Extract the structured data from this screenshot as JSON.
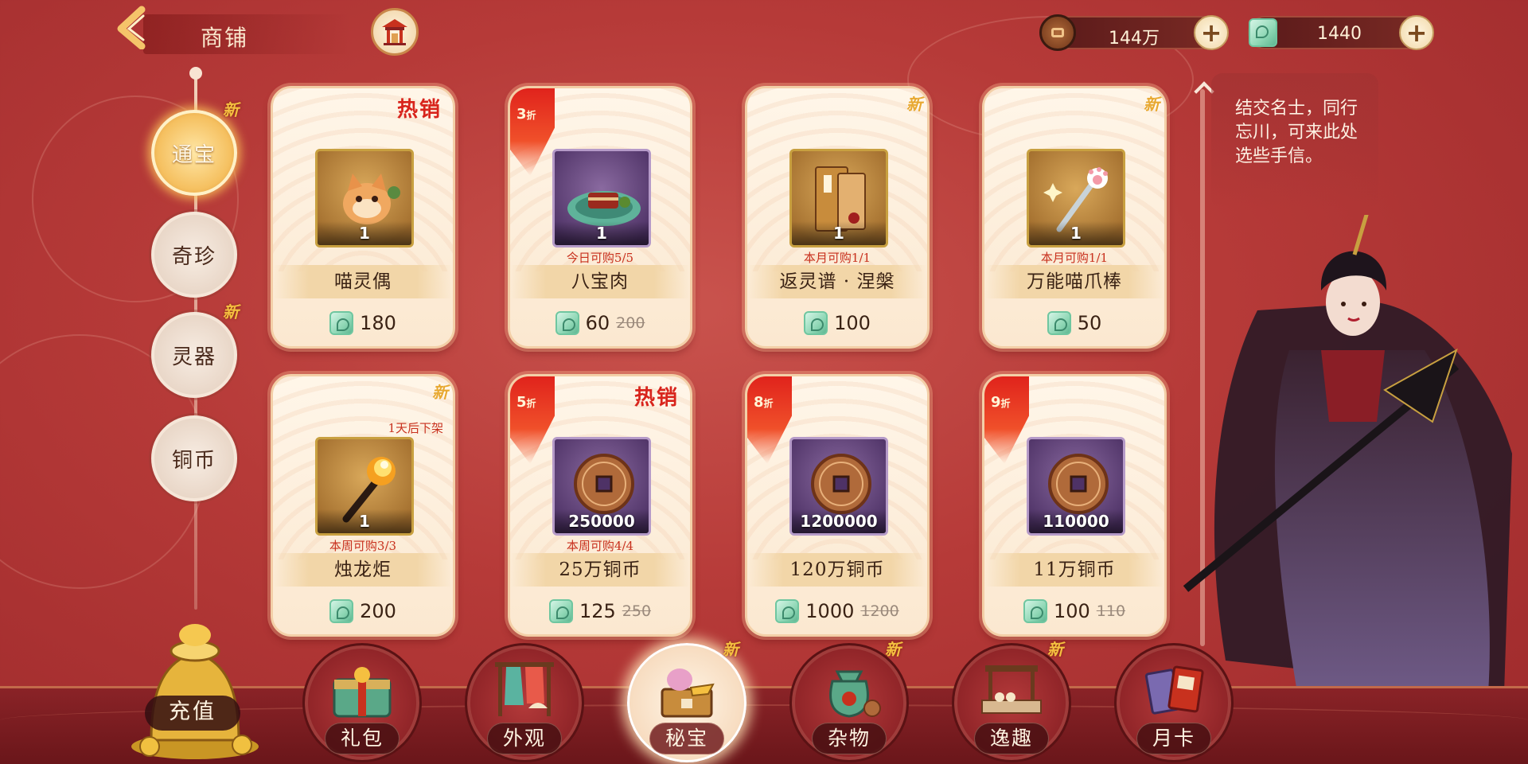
{
  "header": {
    "title": "商铺"
  },
  "currencies": [
    {
      "icon": "copper-coin-icon",
      "value": "144万"
    },
    {
      "icon": "jade-icon",
      "value": "1440"
    }
  ],
  "categories": [
    {
      "label": "通宝",
      "active": true,
      "new": "新"
    },
    {
      "label": "奇珍",
      "active": false,
      "new": ""
    },
    {
      "label": "灵器",
      "active": false,
      "new": "新"
    },
    {
      "label": "铜币",
      "active": false,
      "new": ""
    }
  ],
  "products": [
    {
      "name": "喵灵偶",
      "qty": "1",
      "price": "180",
      "original": "",
      "badge": "热销",
      "discount": "",
      "discount_unit": "",
      "new": "",
      "limit": "",
      "expire": "",
      "icon": "cat-doll-icon"
    },
    {
      "name": "八宝肉",
      "qty": "1",
      "price": "60",
      "original": "200",
      "badge": "",
      "discount": "3",
      "discount_unit": "折",
      "new": "",
      "limit": "今日可购5/5",
      "expire": "",
      "icon": "braised-pork-icon"
    },
    {
      "name": "返灵谱 · 涅槃",
      "qty": "1",
      "price": "100",
      "original": "",
      "badge": "",
      "discount": "",
      "discount_unit": "",
      "new": "新",
      "limit": "本月可购1/1",
      "expire": "",
      "icon": "scroll-book-icon"
    },
    {
      "name": "万能喵爪棒",
      "qty": "1",
      "price": "50",
      "original": "",
      "badge": "",
      "discount": "",
      "discount_unit": "",
      "new": "新",
      "limit": "本月可购1/1",
      "expire": "",
      "icon": "paw-wand-icon"
    },
    {
      "name": "烛龙炬",
      "qty": "1",
      "price": "200",
      "original": "",
      "badge": "",
      "discount": "",
      "discount_unit": "",
      "new": "新",
      "limit": "本周可购3/3",
      "expire": "1天后下架",
      "icon": "torch-icon"
    },
    {
      "name": "25万铜币",
      "qty": "250000",
      "price": "125",
      "original": "250",
      "badge": "热销",
      "discount": "5",
      "discount_unit": "折",
      "new": "",
      "limit": "本周可购4/4",
      "expire": "",
      "icon": "copper-coin-icon"
    },
    {
      "name": "120万铜币",
      "qty": "1200000",
      "price": "1000",
      "original": "1200",
      "badge": "",
      "discount": "8",
      "discount_unit": "折",
      "new": "",
      "limit": "",
      "expire": "",
      "icon": "copper-coin-icon"
    },
    {
      "name": "11万铜币",
      "qty": "110000",
      "price": "100",
      "original": "110",
      "badge": "",
      "discount": "9",
      "discount_unit": "折",
      "new": "",
      "limit": "",
      "expire": "",
      "icon": "copper-coin-icon"
    }
  ],
  "npc": {
    "dialogue": "结交名士，同行忘川，可来此处选些手信。"
  },
  "bottom_nav": [
    {
      "label": "充值",
      "new": ""
    },
    {
      "label": "礼包",
      "new": ""
    },
    {
      "label": "外观",
      "new": ""
    },
    {
      "label": "秘宝",
      "new": "新",
      "active": true
    },
    {
      "label": "杂物",
      "new": "新"
    },
    {
      "label": "逸趣",
      "new": "新"
    },
    {
      "label": "月卡",
      "new": ""
    }
  ],
  "colors": {
    "background": "#b63a38",
    "accent_gold": "#f5c060",
    "hot_red": "#d8241c",
    "jade": "#8fd7b5"
  }
}
